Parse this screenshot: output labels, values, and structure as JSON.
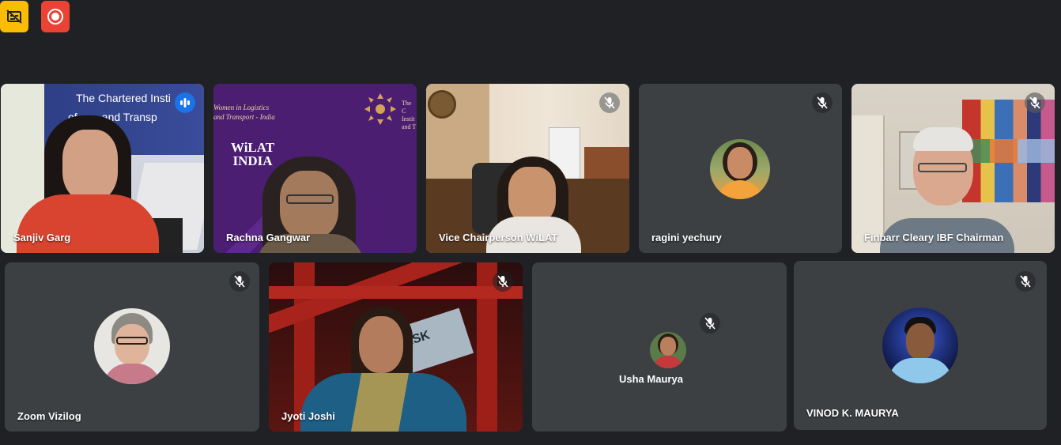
{
  "toolbar": {
    "icons": [
      "captions-off-icon",
      "record-icon"
    ],
    "colors": {
      "captions_bg": "#fbbc04",
      "record_bg": "#ea4335"
    }
  },
  "participants": [
    {
      "name": "Sanjiv Garg",
      "speaking": true,
      "muted": false,
      "video_on": true,
      "background_text": "The Chartered Insti\nof ... and Transp"
    },
    {
      "name": "Rachna Gangwar",
      "speaking": false,
      "muted": false,
      "video_on": true,
      "background_text": "Women in Logistics\nand Transport - India",
      "logo_text": "WiLAT\nINDIA",
      "side_text": "The C\nInstit\nand T"
    },
    {
      "name": "Vice Chairperson WiLAT",
      "speaking": false,
      "muted": true,
      "video_on": true
    },
    {
      "name": "ragini yechury",
      "speaking": false,
      "muted": true,
      "video_on": false
    },
    {
      "name": "Finbarr Cleary IBF Chairman",
      "speaking": false,
      "muted": true,
      "video_on": true
    },
    {
      "name": "Zoom Vizilog",
      "speaking": false,
      "muted": true,
      "video_on": false
    },
    {
      "name": "Jyoti Joshi",
      "speaking": false,
      "muted": true,
      "video_on": true,
      "background_text": "ERSK"
    },
    {
      "name": "Usha Maurya",
      "speaking": false,
      "muted": true,
      "video_on": false
    },
    {
      "name": "VINOD K. MAURYA",
      "speaking": false,
      "muted": true,
      "video_on": false
    }
  ],
  "colors": {
    "background": "#202124",
    "tile": "#3c4043",
    "active_outline": "#8ab4f8",
    "speaking_badge": "#1a73e8"
  }
}
